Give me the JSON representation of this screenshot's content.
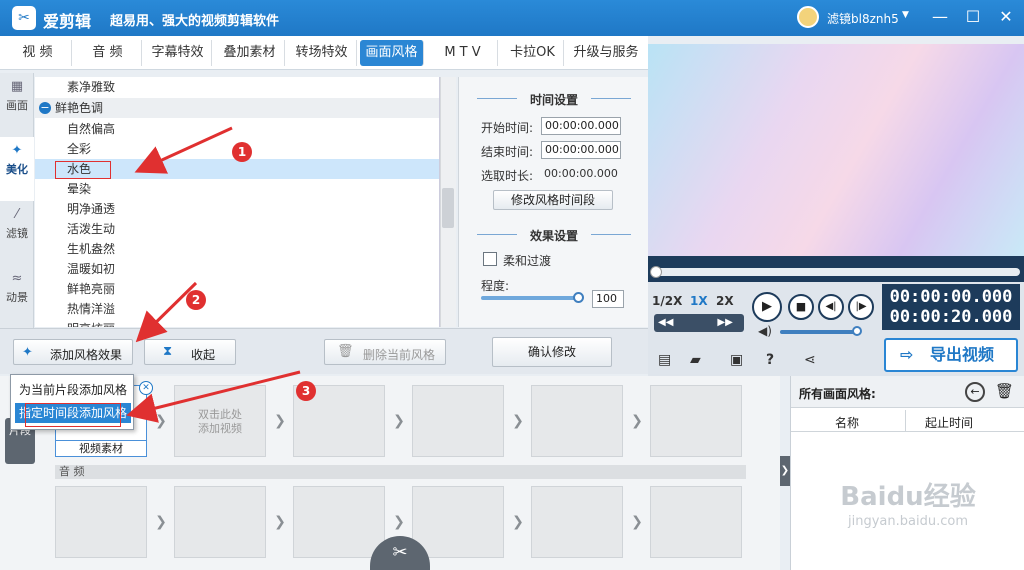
{
  "app": {
    "logo_glyph": "✂",
    "name": "爱剪辑",
    "slogan": "超易用、强大的视频剪辑软件",
    "username": "滤镜bl8znh5"
  },
  "window_controls": {
    "minimize": "—",
    "maximize": "☐",
    "close": "✕"
  },
  "tabs": [
    {
      "label": "视  频"
    },
    {
      "label": "音  频"
    },
    {
      "label": "字幕特效"
    },
    {
      "label": "叠加素材"
    },
    {
      "label": "转场特效"
    },
    {
      "label": "画面风格",
      "active": true
    },
    {
      "label": "M T V"
    },
    {
      "label": "卡拉OK"
    },
    {
      "label": "升级与服务"
    }
  ],
  "side_tabs": [
    {
      "label": "画面",
      "icon": "film-icon"
    },
    {
      "label": "美化",
      "icon": "magic-icon",
      "active": true
    },
    {
      "label": "滤镜",
      "icon": "wand-icon"
    },
    {
      "label": "动景",
      "icon": "waves-icon"
    }
  ],
  "style_list": [
    {
      "label": "素净雅致"
    },
    {
      "label": "鲜艳色调",
      "group": true,
      "expand_glyph": "−"
    },
    {
      "label": "自然偏高"
    },
    {
      "label": "全彩"
    },
    {
      "label": "水色",
      "selected": true
    },
    {
      "label": "晕染"
    },
    {
      "label": "明净通透"
    },
    {
      "label": "活泼生动"
    },
    {
      "label": "生机盎然"
    },
    {
      "label": "温暖如初"
    },
    {
      "label": "鲜艳亮丽"
    },
    {
      "label": "热情洋溢"
    },
    {
      "label": "明亮炫丽"
    }
  ],
  "time_settings": {
    "title": "时间设置",
    "start_label": "开始时间:",
    "start_value": "00:00:00.000",
    "end_label": "结束时间:",
    "end_value": "00:00:00.000",
    "duration_label": "选取时长:",
    "duration_value": "00:00:00.000",
    "modify_period_button": "修改风格时间段"
  },
  "effect_settings": {
    "title": "效果设置",
    "soft_transition_label": "柔和过渡",
    "degree_label": "程度:",
    "degree_value": "100",
    "degree_fraction": 1.0
  },
  "toolbar": {
    "add_effect_button": "添加风格效果",
    "collapse_button": "收起",
    "delete_button": "删除当前风格",
    "confirm_button": "确认修改"
  },
  "popup_menu": [
    {
      "label": "为当前片段添加风格"
    },
    {
      "label": "指定时间段添加风格",
      "highlighted": true
    }
  ],
  "timeline": {
    "section_label": "片段",
    "double_click_hint": "双击此处\n添加视频",
    "video_clip_label": "视频素材",
    "audio_track_label": "音 频"
  },
  "player": {
    "speed_options": [
      "1/2X",
      "1X",
      "2X"
    ],
    "active_speed": "1X",
    "current_time": "00:00:00.000",
    "total_time": "00:00:20.000",
    "export_button": "导出视频"
  },
  "right_panel": {
    "title": "所有画面风格:",
    "col_name": "名称",
    "col_time": "起止时间"
  },
  "annotations": [
    {
      "number": "1"
    },
    {
      "number": "2"
    },
    {
      "number": "3"
    }
  ],
  "colors": {
    "accent": "#1f78c6",
    "annotation_red": "#e03030",
    "selected_row": "#cde6fb"
  },
  "watermark": {
    "text": "Baidu经验",
    "subtext": "jingyan.baidu.com"
  }
}
